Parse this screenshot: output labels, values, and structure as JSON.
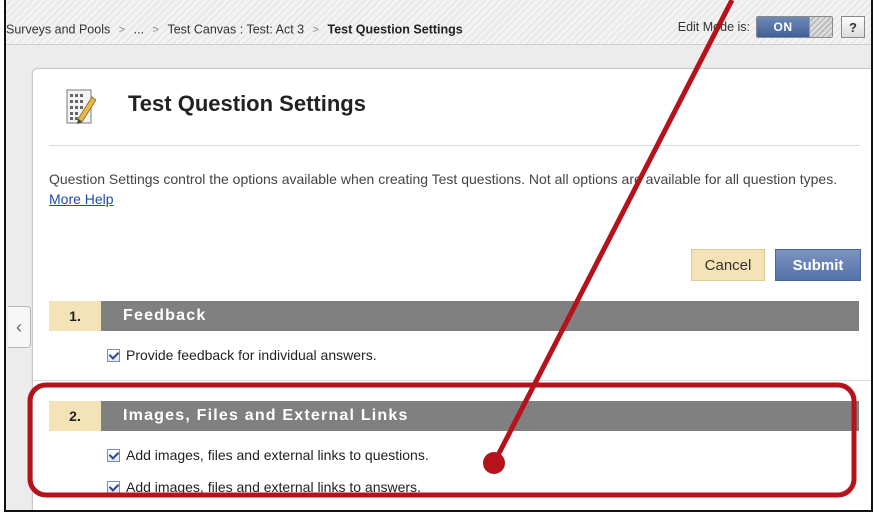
{
  "breadcrumb": {
    "items": [
      "Surveys and Pools",
      "...",
      "Test Canvas : Test: Act 3"
    ],
    "separator": ">",
    "current": "Test Question Settings"
  },
  "edit_mode": {
    "label": "Edit Mode is:",
    "state": "ON",
    "help_label": "?"
  },
  "page": {
    "title": "Test Question Settings",
    "icon": "test-settings-pencil-icon",
    "intro_text": "Question Settings control the options available when creating Test questions. Not all options are available for all question types.",
    "help_link": "More Help"
  },
  "actions": {
    "cancel_label": "Cancel",
    "submit_label": "Submit"
  },
  "sections": [
    {
      "number": "1.",
      "title": "Feedback",
      "options": [
        {
          "label": "Provide feedback for individual answers.",
          "checked": true
        }
      ]
    },
    {
      "number": "2.",
      "title": "Images, Files and External Links",
      "options": [
        {
          "label": "Add images, files and external links to questions.",
          "checked": true
        },
        {
          "label": "Add images, files and external links to answers.",
          "checked": true
        }
      ]
    }
  ],
  "colors": {
    "section_number_bg": "#f5e3b8",
    "section_title_bg": "#808080",
    "submit_bg": "#5572a8",
    "annotation": "#b5121b"
  }
}
